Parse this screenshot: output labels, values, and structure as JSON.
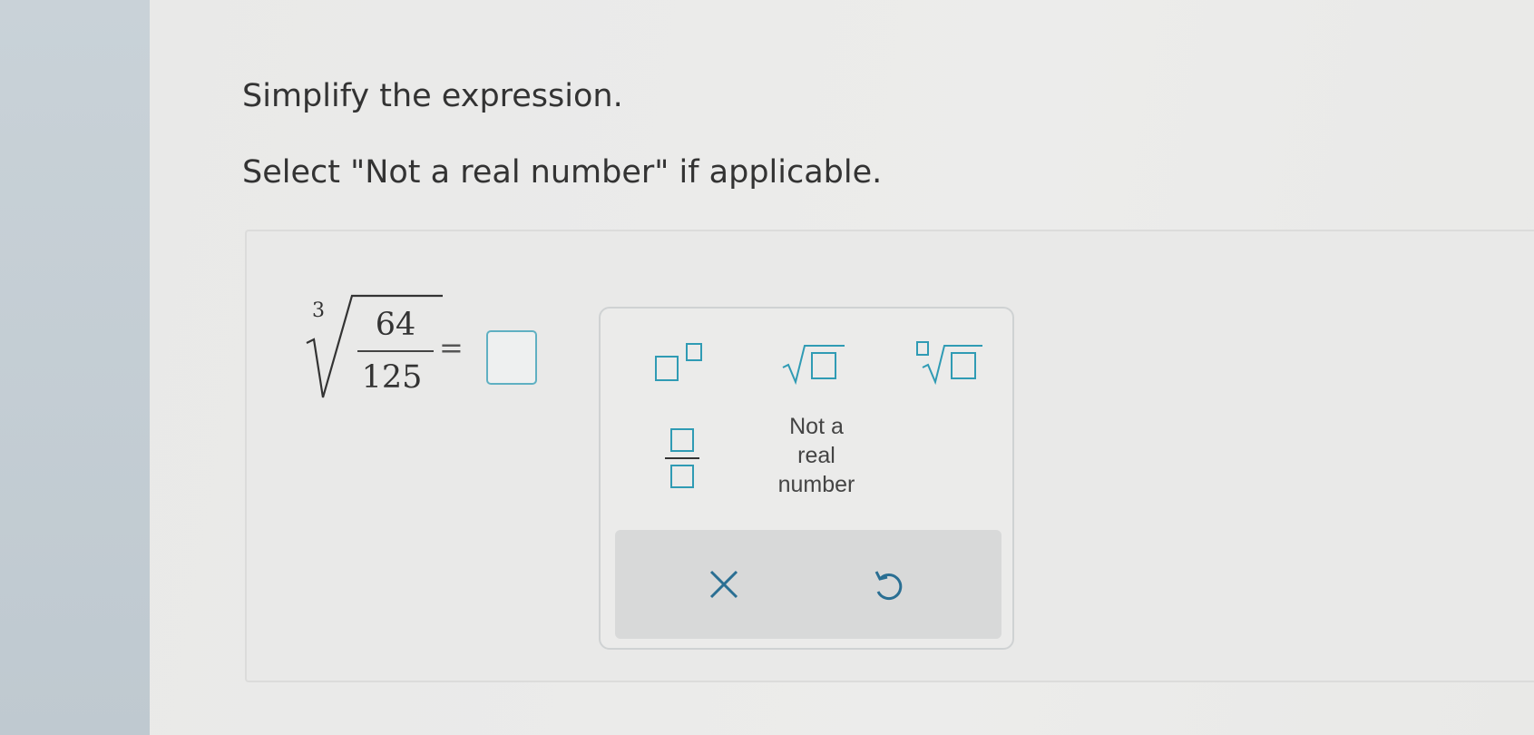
{
  "question": {
    "line1": "Simplify the expression.",
    "line2": "Select \"Not a real number\" if applicable."
  },
  "expression": {
    "root_index": "3",
    "numerator": "64",
    "denominator": "125",
    "equals": "="
  },
  "answer": {
    "value": ""
  },
  "keypad": {
    "keys": [
      {
        "name": "exponent",
        "icon": "exponent-template-icon"
      },
      {
        "name": "square-root",
        "icon": "square-root-template-icon"
      },
      {
        "name": "nth-root",
        "icon": "nth-root-template-icon"
      },
      {
        "name": "fraction",
        "icon": "fraction-template-icon"
      }
    ],
    "not_real": {
      "line1": "Not a",
      "line2": "real",
      "line3": "number"
    },
    "clear_icon": "close-icon",
    "undo_icon": "undo-icon"
  },
  "colors": {
    "accent": "#2f9bb4",
    "text": "#333333",
    "keypad_bar": "#d8d9d9"
  }
}
